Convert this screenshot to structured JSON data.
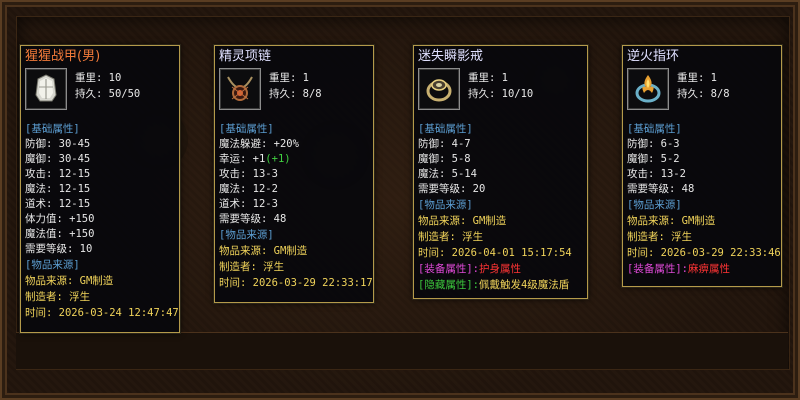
{
  "cards": [
    {
      "title": "猩猩战甲(男)",
      "icon": "armor-icon",
      "weight": "重里: 10",
      "durability": "持久: 50/50",
      "base_header": "[基础属性]",
      "base_stats": [
        "防御: 30-45",
        "魔御: 30-45",
        "攻击: 12-15",
        "魔法: 12-15",
        "道术: 12-15",
        "体力值: +150",
        "魔法值: +150",
        "需要等级: 10"
      ],
      "source_header": "[物品来源]",
      "source": "物品来源: GM制造",
      "maker": "制造者: 浮生",
      "time": "时间: 2026-03-24 12:47:47"
    },
    {
      "title": "精灵项链",
      "icon": "necklace-icon",
      "weight": "重里: 1",
      "durability": "持久: 8/8",
      "base_header": "[基础属性]",
      "base_stats": [
        "魔法躲避: +20%",
        "幸运: +1",
        "攻击: 13-3",
        "魔法: 12-2",
        "道术: 12-3",
        "需要等级: 48"
      ],
      "luck_bonus": "(+1)",
      "source_header": "[物品来源]",
      "source": "物品来源: GM制造",
      "maker": "制造者: 浮生",
      "time": "时间: 2026-03-29 22:33:17"
    },
    {
      "title": "迷失瞬影戒",
      "icon": "ring-icon",
      "weight": "重里: 1",
      "durability": "持久: 10/10",
      "base_header": "[基础属性]",
      "base_stats": [
        "防御: 4-7",
        "魔御: 5-8",
        "魔法: 5-14",
        "需要等级: 20"
      ],
      "source_header": "[物品来源]",
      "source": "物品来源: GM制造",
      "maker": "制造者: 浮生",
      "time": "时间: 2026-04-01 15:17:54",
      "equip_label": "[装备属性]:",
      "equip_value": "护身属性",
      "hidden_label": "[隐藏属性]:",
      "hidden_value": "佩戴触发4级魔法盾"
    },
    {
      "title": "逆火指环",
      "icon": "fire-ring-icon",
      "weight": "重里: 1",
      "durability": "持久: 8/8",
      "base_header": "[基础属性]",
      "base_stats": [
        "防御: 6-3",
        "魔御: 5-2",
        "攻击: 13-2",
        "需要等级: 48"
      ],
      "source_header": "[物品来源]",
      "source": "物品来源: GM制造",
      "maker": "制造者: 浮生",
      "time": "时间: 2026-03-29 22:33:46",
      "equip_label": "[装备属性]:",
      "equip_value": "麻痹属性"
    }
  ],
  "colors": {
    "title_armor": "#f07a3a",
    "title_default": "#e0e0ff",
    "section": "#5c9ed2",
    "gold": "#f0d35a",
    "green": "#40d040",
    "magenta": "#e04ad8",
    "red": "#ff3434"
  }
}
